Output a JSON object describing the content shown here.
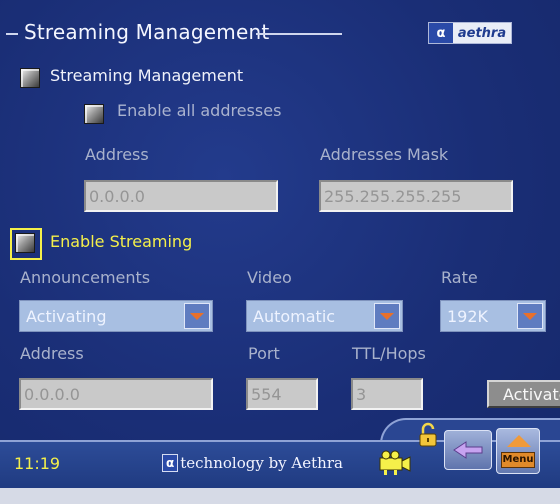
{
  "header": {
    "title": "Streaming Management",
    "brand_alpha": "α",
    "brand_name": "aethra"
  },
  "streaming_management": {
    "checkbox_label": "Streaming Management",
    "enable_all_label": "Enable all addresses",
    "address_label": "Address",
    "address_value": "0.0.0.0",
    "mask_label": "Addresses Mask",
    "mask_value": "255.255.255.255"
  },
  "enable_streaming": {
    "checkbox_label": "Enable Streaming",
    "announcements_label": "Announcements",
    "announcements_value": "Activating",
    "video_label": "Video",
    "video_value": "Automatic",
    "rate_label": "Rate",
    "rate_value": "192K",
    "address_label": "Address",
    "address_value": "0.0.0.0",
    "port_label": "Port",
    "port_value": "554",
    "ttl_label": "TTL/Hops",
    "ttl_value": "3",
    "activate_button": "Activate"
  },
  "status_bar": {
    "time": "11:19",
    "tech_alpha": "α",
    "tech_text": "technology by Aethra",
    "menu_label": "Menu"
  },
  "colors": {
    "background": "#1b2f78",
    "accent_yellow": "#f5f04a",
    "select_bg": "#a8bfe2",
    "arrow_orange": "#e8702a"
  },
  "icons": [
    "camera-icon",
    "lock-icon",
    "back-arrow-icon",
    "menu-home-icon"
  ]
}
